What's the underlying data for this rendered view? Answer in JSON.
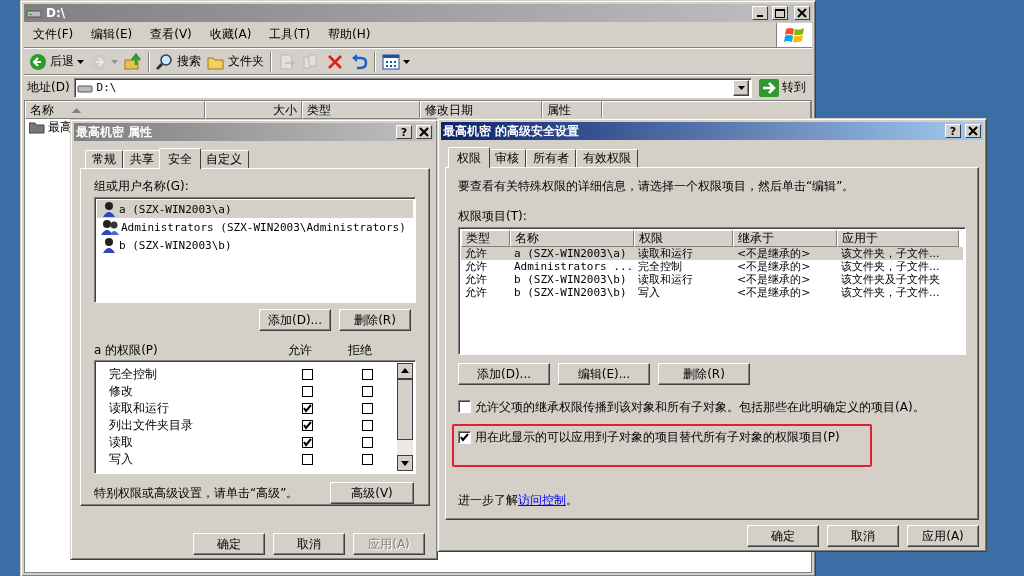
{
  "explorer": {
    "title": "D:\\",
    "menu": [
      "文件(F)",
      "编辑(E)",
      "查看(V)",
      "收藏(A)",
      "工具(T)",
      "帮助(H)"
    ],
    "toolbar": [
      {
        "kind": "back",
        "label": "后退",
        "disabled": false
      },
      {
        "kind": "forward",
        "disabled": true
      },
      {
        "kind": "up",
        "disabled": false
      },
      {
        "kind": "search",
        "label": "搜索",
        "disabled": false
      },
      {
        "kind": "folders",
        "label": "文件夹",
        "disabled": false
      },
      {
        "kind": "move",
        "disabled": true
      },
      {
        "kind": "copy",
        "disabled": true
      },
      {
        "kind": "delete",
        "disabled": false
      },
      {
        "kind": "undo",
        "disabled": false
      },
      {
        "kind": "views",
        "disabled": false
      }
    ],
    "address_label": "地址(D)",
    "address": "D:\\",
    "go_button": "转到",
    "columns": [
      "名称",
      "大小",
      "类型",
      "修改日期",
      "属性"
    ],
    "files": [
      {
        "name": "最高"
      }
    ]
  },
  "properties": {
    "title": "最高机密 属性",
    "help": "?",
    "tabs": [
      {
        "label": "常规",
        "selected": false
      },
      {
        "label": "共享",
        "selected": false
      },
      {
        "label": "安全",
        "selected": true
      },
      {
        "label": "自定义",
        "selected": false
      }
    ],
    "users_label": "组或用户名称(G):",
    "users": [
      {
        "kind": "user",
        "name": "a (SZX-WIN2003\\a)",
        "selected": true
      },
      {
        "kind": "group",
        "name": "Administrators (SZX-WIN2003\\Administrators)",
        "selected": false
      },
      {
        "kind": "user",
        "name": "b (SZX-WIN2003\\b)",
        "selected": false
      }
    ],
    "user_buttons": [
      "添加(D)...",
      "删除(R)"
    ],
    "permissions_label": "a 的权限(P)",
    "allow_header": "允许",
    "deny_header": "拒绝",
    "permissions": [
      {
        "name": "完全控制",
        "allow": false,
        "deny": false
      },
      {
        "name": "修改",
        "allow": false,
        "deny": false
      },
      {
        "name": "读取和运行",
        "allow": true,
        "deny": false
      },
      {
        "name": "列出文件夹目录",
        "allow": true,
        "deny": false
      },
      {
        "name": "读取",
        "allow": true,
        "deny": false
      },
      {
        "name": "写入",
        "allow": false,
        "deny": false
      }
    ],
    "hint": "特别权限或高级设置，请单击“高级”。",
    "advanced_button": "高级(V)",
    "buttons": [
      {
        "label": "确定",
        "disabled": false
      },
      {
        "label": "取消",
        "disabled": false
      },
      {
        "label": "应用(A)",
        "disabled": true
      }
    ]
  },
  "advanced": {
    "title": "最高机密 的高级安全设置",
    "help": "?",
    "tabs": [
      {
        "label": "权限",
        "selected": true
      },
      {
        "label": "审核",
        "selected": false
      },
      {
        "label": "所有者",
        "selected": false
      },
      {
        "label": "有效权限",
        "selected": false
      }
    ],
    "intro": "要查看有关特殊权限的详细信息，请选择一个权限项目，然后单击“编辑”。",
    "entries_label": "权限项目(T):",
    "columns": [
      "类型",
      "名称",
      "权限",
      "继承于",
      "应用于"
    ],
    "entries": [
      {
        "cells": [
          "允许",
          "a (SZX-WIN2003\\a)",
          "读取和运行",
          "<不是继承的>",
          "该文件夹，子文件..."
        ],
        "selected": true
      },
      {
        "cells": [
          "允许",
          "Administrators ...",
          "完全控制",
          "<不是继承的>",
          "该文件夹，子文件..."
        ],
        "selected": false
      },
      {
        "cells": [
          "允许",
          "b (SZX-WIN2003\\b)",
          "读取和运行",
          "<不是继承的>",
          "该文件夹及子文件夹"
        ],
        "selected": false
      },
      {
        "cells": [
          "允许",
          "b (SZX-WIN2003\\b)",
          "写入",
          "<不是继承的>",
          "该文件夹，子文件..."
        ],
        "selected": false
      }
    ],
    "entry_buttons": [
      "添加(D)...",
      "编辑(E)...",
      "删除(R)"
    ],
    "options": [
      {
        "label": "允许父项的继承权限传播到该对象和所有子对象。包括那些在此明确定义的项目(A)。",
        "checked": false,
        "highlighted": false
      },
      {
        "label": "用在此显示的可以应用到子对象的项目替代所有子对象的权限项目(P)",
        "checked": true,
        "highlighted": true
      }
    ],
    "learn_text": "进一步了解",
    "learn_link": "访问控制",
    "learn_end": "。",
    "buttons": [
      {
        "label": "确定",
        "disabled": false
      },
      {
        "label": "取消",
        "disabled": false
      },
      {
        "label": "应用(A)",
        "disabled": false
      }
    ]
  }
}
